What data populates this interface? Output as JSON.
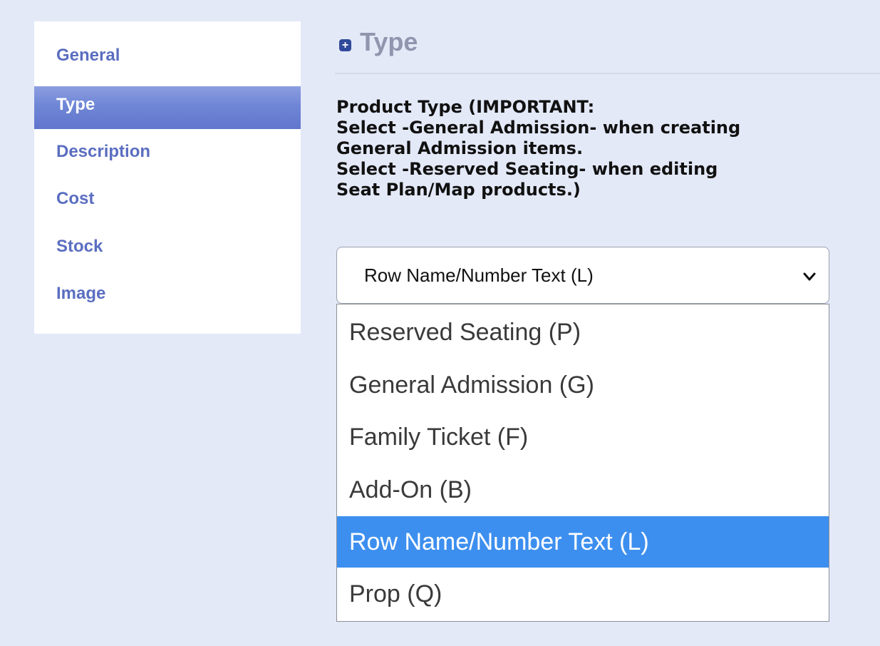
{
  "sidebar": {
    "items": [
      {
        "label": "General",
        "active": false
      },
      {
        "label": "Type",
        "active": true
      },
      {
        "label": "Description",
        "active": false
      },
      {
        "label": "Cost",
        "active": false
      },
      {
        "label": "Stock",
        "active": false
      },
      {
        "label": "Image",
        "active": false
      }
    ]
  },
  "section": {
    "icon": "plus-square-icon",
    "title": "Type"
  },
  "field": {
    "label_lines": [
      "Product Type (IMPORTANT:",
      "Select -General Admission- when creating",
      "General Admission items.",
      "Select -Reserved Seating- when editing",
      "Seat Plan/Map products.)"
    ]
  },
  "select": {
    "value": "Row Name/Number Text (L)",
    "options": [
      "Reserved Seating (P)",
      "General Admission (G)",
      "Family Ticket (F)",
      "Add-On (B)",
      "Row Name/Number Text (L)",
      "Prop (Q)"
    ],
    "selected_index": 4
  },
  "colors": {
    "page_background": "#e4e9f8",
    "sidebar_link": "#5a6ec0",
    "sidebar_active": "#6f86d6",
    "option_highlight": "#3d8fef"
  }
}
